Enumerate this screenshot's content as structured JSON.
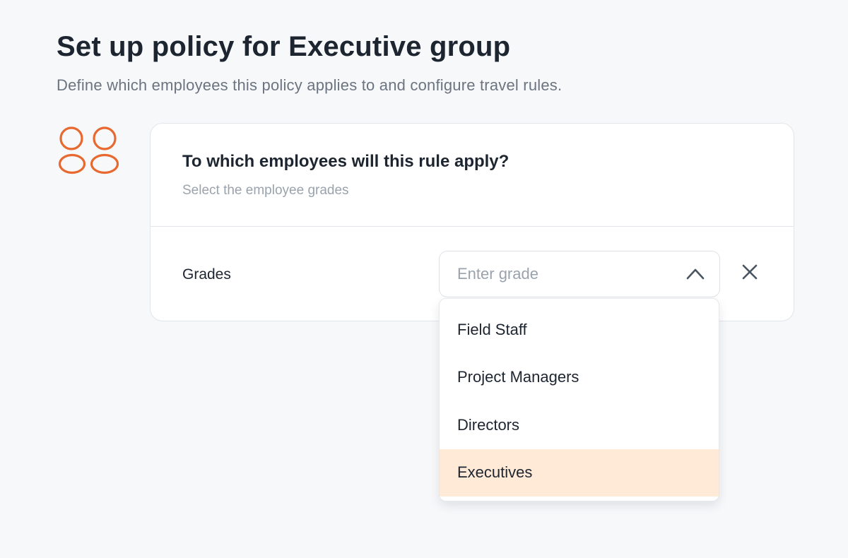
{
  "page": {
    "title": "Set up policy for Executive group",
    "subtitle": "Define which employees this policy applies to and configure travel rules."
  },
  "icons": {
    "group": "group-icon",
    "chevron": "chevron-up-icon",
    "clear": "close-icon"
  },
  "colors": {
    "accent": "#e8692f",
    "selected_option_bg": "#ffead8"
  },
  "card": {
    "title": "To which employees will this rule apply?",
    "subtitle": "Select the employee grades",
    "grades_label": "Grades",
    "grade_input": {
      "value": "",
      "placeholder": "Enter grade"
    }
  },
  "dropdown": {
    "options": [
      {
        "label": "Field Staff",
        "selected": false
      },
      {
        "label": "Project Managers",
        "selected": false
      },
      {
        "label": "Directors",
        "selected": false
      },
      {
        "label": "Executives",
        "selected": true
      }
    ]
  }
}
